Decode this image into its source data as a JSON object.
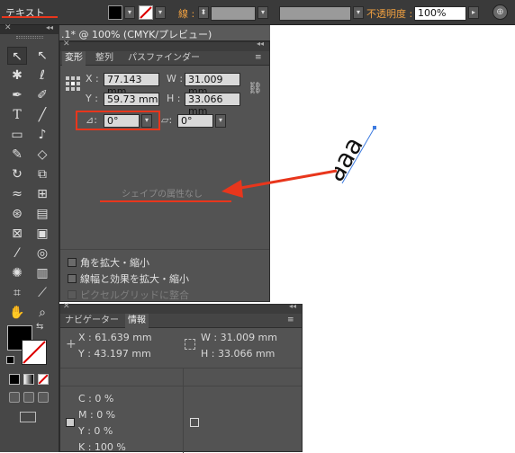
{
  "control_bar": {
    "tool_name": "テキスト",
    "stroke_label": "線 :",
    "opacity_label": "不透明度 :",
    "opacity_value": "100%"
  },
  "document_tab": {
    "title": ".1* @ 100% (CMYK/プレビュー)"
  },
  "transform_panel": {
    "tabs": [
      "変形",
      "整列",
      "パスファインダー"
    ],
    "x_label": "X :",
    "x_value": "77.143 mm",
    "y_label": "Y :",
    "y_value": "59.73 mm",
    "w_label": "W :",
    "w_value": "31.009 mm",
    "h_label": "H :",
    "h_value": "33.066 mm",
    "rotate_value": "0°",
    "shear_value": "0°",
    "no_shape_properties": "シェイプの属性なし",
    "checkboxes": [
      {
        "label": "角を拡大・縮小",
        "enabled": true
      },
      {
        "label": "線幅と効果を拡大・縮小",
        "enabled": true
      },
      {
        "label": "ピクセルグリッドに整合",
        "enabled": false
      }
    ]
  },
  "info_panel": {
    "tabs": [
      "ナビゲーター",
      "情報"
    ],
    "x_value": "X : 61.639 mm",
    "y_value": "Y : 43.197 mm",
    "w_value": "W : 31.009 mm",
    "h_value": "H : 33.066 mm",
    "c_value": "C : 0 %",
    "m_value": "M : 0 %",
    "y2_value": "Y : 0 %",
    "k_value": "K : 100 %"
  },
  "canvas": {
    "text_object": "aaa"
  },
  "colors": {
    "annotation_red": "#e8361c",
    "selection_blue": "#3d7be0",
    "opacity_label_color": "#f0a040",
    "stroke_label_color": "#f0a040"
  }
}
